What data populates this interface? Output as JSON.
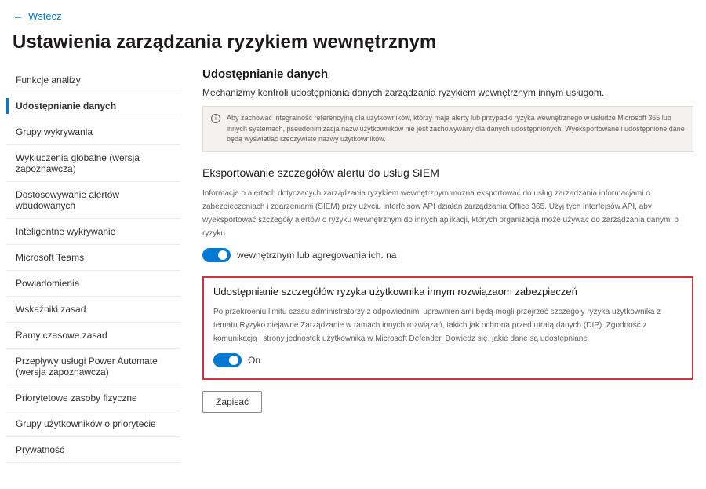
{
  "back": {
    "label": "Wstecz"
  },
  "page": {
    "title": "Ustawienia zarządzania ryzykiem wewnętrznym"
  },
  "sidebar": {
    "items": [
      {
        "label": "Funkcje analizy"
      },
      {
        "label": "Udostępnianie danych"
      },
      {
        "label": "Grupy wykrywania"
      },
      {
        "label": "Wykluczenia globalne (wersja zapoznawcza)"
      },
      {
        "label": "Dostosowywanie alertów wbudowanych"
      },
      {
        "label": "Inteligentne wykrywanie"
      },
      {
        "label": "Microsoft Teams"
      },
      {
        "label": "Powiadomienia"
      },
      {
        "label": "Wskaźniki zasad"
      },
      {
        "label": "Ramy czasowe zasad"
      },
      {
        "label": "Przepływy usługi Power Automate (wersja zapoznawcza)"
      },
      {
        "label": "Priorytetowe zasoby fizyczne"
      },
      {
        "label": "Grupy użytkowników o priorytecie"
      },
      {
        "label": "Prywatność"
      }
    ],
    "activeIndex": 1
  },
  "main": {
    "section_title": "Udostępnianie danych",
    "section_subtitle": "Mechanizmy kontroli udostępniania danych zarządzania ryzykiem wewnętrznym innym usługom.",
    "info_text": "Aby zachować integralność referencyjną dla użytkowników, którzy mają alerty lub przypadki ryzyka wewnętrznego w usłudze Microsoft 365 lub innych systemach, pseudonimizacja nazw użytkowników nie jest zachowywany dla danych udostępnionych. Wyeksportowane i udostępnione dane będą wyświetlać rzeczywiste nazwy użytkowników.",
    "siem": {
      "title": "Eksportowanie szczegółów alertu do usług SIEM",
      "description": "Informacje o alertach dotyczących zarządzania ryzykiem wewnętrznym można eksportować do usług zarządzania informacjami o zabezpieczeniach i zdarzeniami (SIEM) przy użyciu interfejsów API działań zarządzania Office 365. Użyj tych interfejsów API, aby wyeksportować szczegóły alertów o ryzyku wewnętrznym do innych aplikacji, których organizacja może używać do zarządzania danymi o ryzyku",
      "toggle_label": "wewnętrznym lub agregowania ich. na"
    },
    "risk_share": {
      "title": "Udostępnianie szczegółów ryzyka użytkownika innym rozwiązaom zabezpieczeń",
      "description": "Po przekroeniu limitu czasu administratorzy z odpowiednimi uprawnieniami będą mogli przejrzeć szczegóły ryzyka użytkownika z tematu Ryzyko niejawne Zarządzanie w ramach innych rozwiązań, takich jak ochrona przed utratą danych (DIP). Zgodność z komunikacją i strony jednostek użytkownika w Microsoft Defender. Dowiedz się, jakie dane są udostępniane",
      "toggle_label": "On"
    },
    "save_label": "Zapisać"
  }
}
